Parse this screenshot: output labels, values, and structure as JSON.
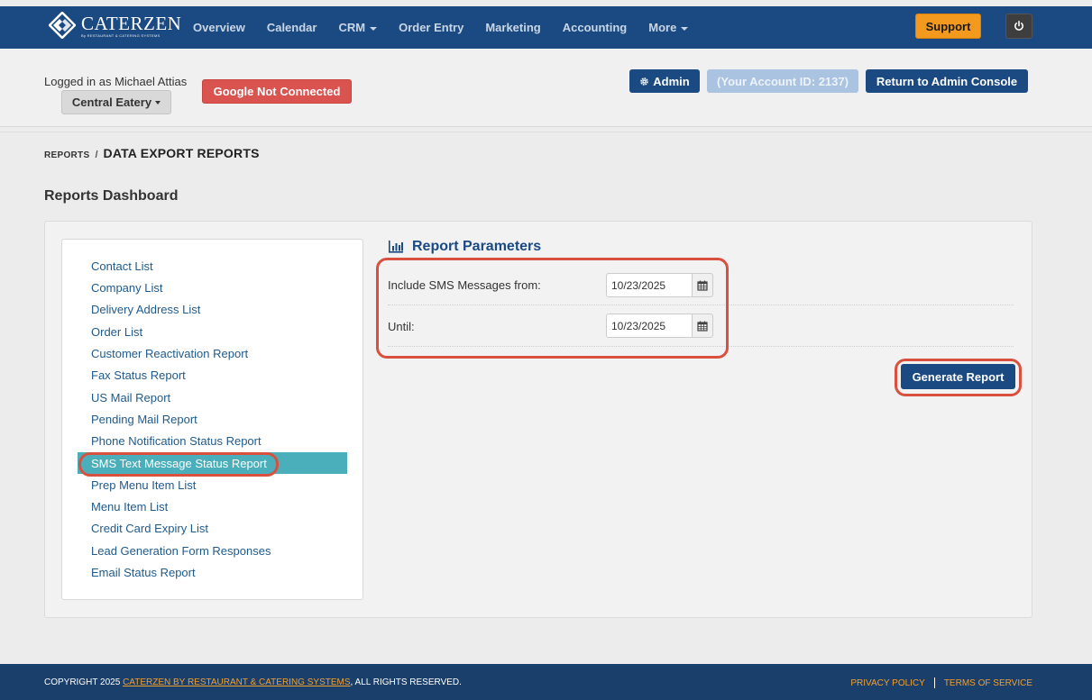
{
  "brand": {
    "name": "CATERZEN",
    "tagline": "By RESTAURANT & CATERING SYSTEMS",
    "nav_color": "#1b4a82",
    "accent": "#f39a1e"
  },
  "nav": {
    "items": [
      {
        "label": "Overview",
        "dropdown": false
      },
      {
        "label": "Calendar",
        "dropdown": false
      },
      {
        "label": "CRM",
        "dropdown": true
      },
      {
        "label": "Order Entry",
        "dropdown": false
      },
      {
        "label": "Marketing",
        "dropdown": false
      },
      {
        "label": "Accounting",
        "dropdown": false
      },
      {
        "label": "More",
        "dropdown": true
      }
    ],
    "support_label": "Support",
    "power_icon": "power-icon"
  },
  "header": {
    "logged_in_text": "Logged in as Michael Attias",
    "location_label": "Central Eatery",
    "google_status": "Google Not Connected",
    "admin_label": "Admin",
    "admin_icon": "gear-icon",
    "account_id_label": "(Your Account ID: 2137)",
    "return_label": "Return to Admin Console"
  },
  "breadcrumb": {
    "root": "REPORTS",
    "separator": "/",
    "current": "DATA EXPORT REPORTS"
  },
  "page_title": "Reports Dashboard",
  "reports": {
    "items": [
      "Contact List",
      "Company List",
      "Delivery Address List",
      "Order List",
      "Customer Reactivation Report",
      "Fax Status Report",
      "US Mail Report",
      "Pending Mail Report",
      "Phone Notification Status Report",
      "SMS Text Message Status Report",
      "Prep Menu Item List",
      "Menu Item List",
      "Credit Card Expiry List",
      "Lead Generation Form Responses",
      "Email Status Report"
    ],
    "active_index": 9,
    "active_color": "#4aafba"
  },
  "params": {
    "title": "Report Parameters",
    "title_icon": "bar-chart-icon",
    "from_label": "Include SMS Messages from:",
    "from_value": "10/23/2025",
    "until_label": "Until:",
    "until_value": "10/23/2025",
    "calendar_icon": "calendar-icon",
    "generate_label": "Generate Report"
  },
  "footer": {
    "copyright_prefix": "COPYRIGHT 2025 ",
    "copyright_link": "CATERZEN BY RESTAURANT & CATERING SYSTEMS",
    "copyright_suffix": ", ALL RIGHTS RESERVED.",
    "privacy": "PRIVACY POLICY",
    "terms": "TERMS OF SERVICE"
  }
}
